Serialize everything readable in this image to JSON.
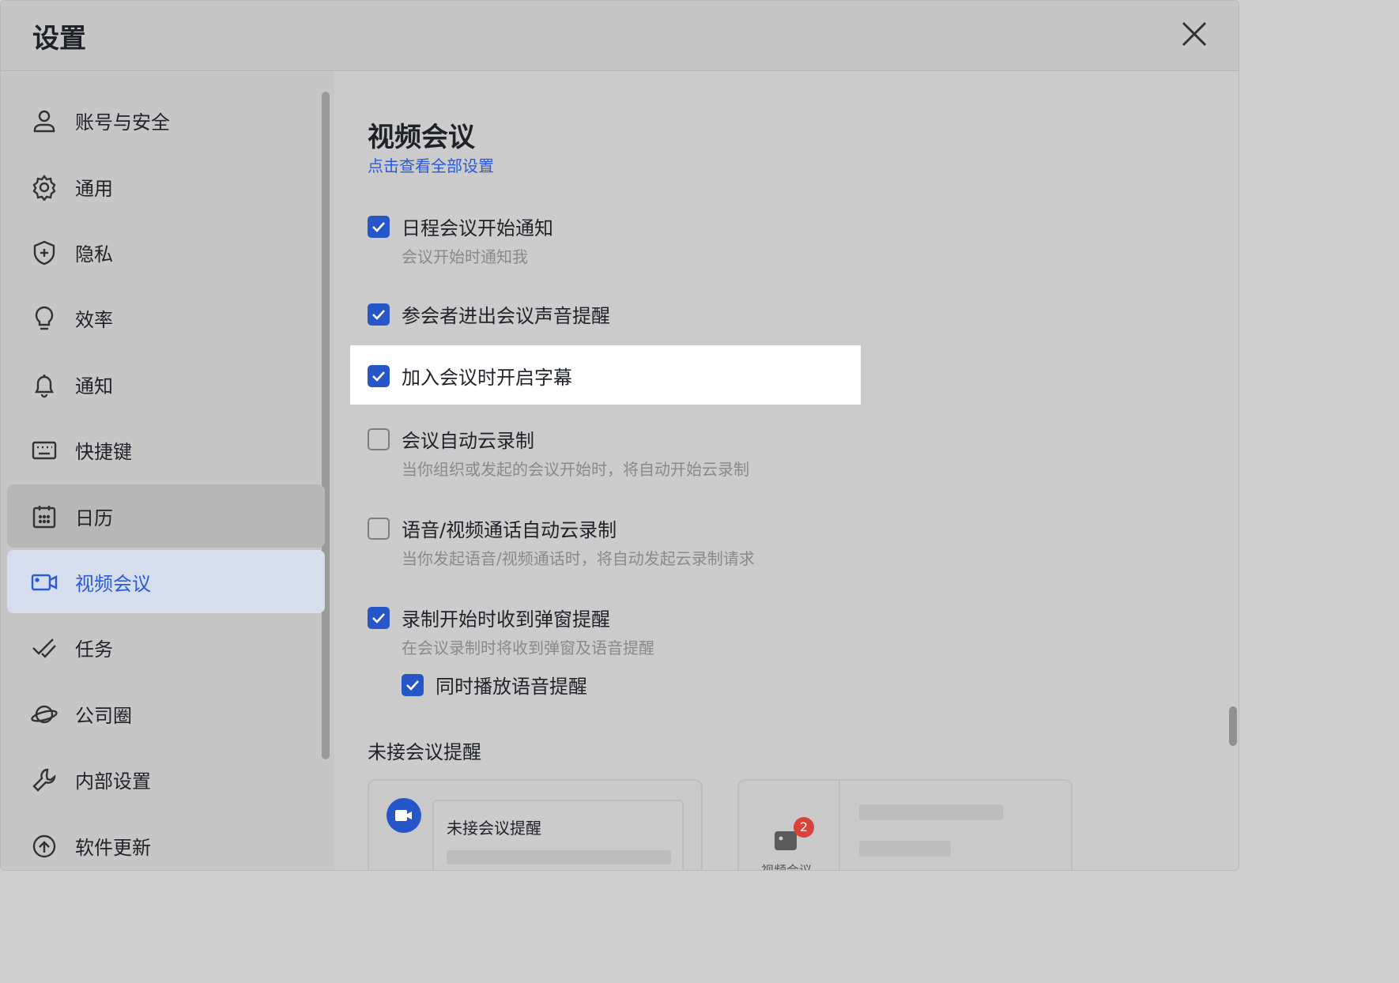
{
  "window": {
    "title": "设置"
  },
  "sidebar": {
    "items": [
      {
        "label": "账号与安全",
        "icon": "user-icon"
      },
      {
        "label": "通用",
        "icon": "gear-icon"
      },
      {
        "label": "隐私",
        "icon": "shield-icon"
      },
      {
        "label": "效率",
        "icon": "lightbulb-icon"
      },
      {
        "label": "通知",
        "icon": "bell-icon"
      },
      {
        "label": "快捷键",
        "icon": "keyboard-icon"
      },
      {
        "label": "日历",
        "icon": "calendar-icon"
      },
      {
        "label": "视频会议",
        "icon": "video-camera-icon"
      },
      {
        "label": "任务",
        "icon": "task-check-icon"
      },
      {
        "label": "公司圈",
        "icon": "planet-icon"
      },
      {
        "label": "内部设置",
        "icon": "wrench-icon"
      },
      {
        "label": "软件更新",
        "icon": "update-icon"
      }
    ],
    "hover_item": "日历",
    "active_item": "视频会议"
  },
  "main": {
    "title": "视频会议",
    "link": "点击查看全部设置",
    "options": [
      {
        "label": "日程会议开始通知",
        "desc": "会议开始时通知我",
        "checked": true
      },
      {
        "label": "参会者进出会议声音提醒",
        "desc": "",
        "checked": true
      },
      {
        "label": "加入会议时开启字幕",
        "desc": "",
        "checked": true
      },
      {
        "label": "会议自动云录制",
        "desc": "当你组织或发起的会议开始时，将自动开始云录制",
        "checked": false
      },
      {
        "label": "语音/视频通话自动云录制",
        "desc": "当你发起语音/视频通话时，将自动发起云录制请求",
        "checked": false
      },
      {
        "label": "录制开始时收到弹窗提醒",
        "desc": "在会议录制时将收到弹窗及语音提醒",
        "checked": true
      },
      {
        "label": "同时播放语音提醒",
        "desc": "",
        "checked": true
      }
    ],
    "missed_section": {
      "title": "未接会议提醒",
      "preview_popup_label": "未接会议提醒",
      "preview_badge_count": "2",
      "preview_icon_label": "视频会议"
    }
  },
  "colors": {
    "accent": "#2656c8",
    "link": "#2a5bd7",
    "active_bg": "#d6deee",
    "badge": "#d9423a"
  }
}
